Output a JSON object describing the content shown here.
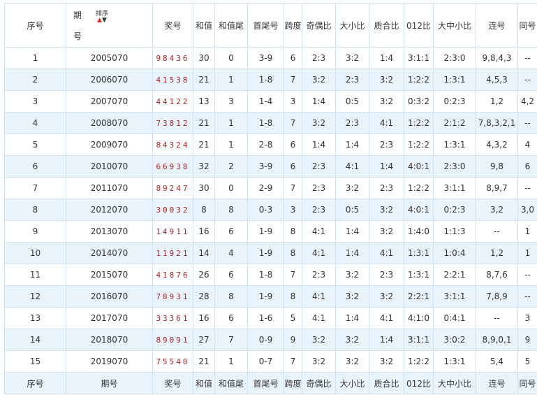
{
  "headers": {
    "index": "序号",
    "period_part1": "期",
    "period_part2": "号",
    "sort_label": "排序",
    "sort_up": "▲",
    "sort_down": "▼",
    "numbers": "奖号",
    "sum": "和值",
    "sum_tail": "和值尾",
    "first_last": "首尾号",
    "span": "跨度",
    "odd_even": "奇偶比",
    "big_small": "大小比",
    "prime_composite": "质合比",
    "ratio_012": "012比",
    "big_mid_small": "大中小比",
    "consecutive": "连号",
    "same": "同号"
  },
  "footer": {
    "index": "序号",
    "period": "期号",
    "numbers": "奖号",
    "sum": "和值",
    "sum_tail": "和值尾",
    "first_last": "首尾号",
    "span": "跨度",
    "odd_even": "奇偶比",
    "big_small": "大小比",
    "prime_composite": "质合比",
    "ratio_012": "012比",
    "big_mid_small": "大中小比",
    "consecutive": "连号",
    "same": "同号"
  },
  "rows": [
    [
      "1",
      "2005070",
      "98436",
      "30",
      "0",
      "3-9",
      "6",
      "2:3",
      "3:2",
      "1:4",
      "3:1:1",
      "2:3:0",
      "9,8,4,3",
      "--"
    ],
    [
      "2",
      "2006070",
      "41538",
      "21",
      "1",
      "1-8",
      "7",
      "3:2",
      "2:3",
      "3:2",
      "1:2:2",
      "1:3:1",
      "4,5,3",
      "--"
    ],
    [
      "3",
      "2007070",
      "44122",
      "13",
      "3",
      "1-4",
      "3",
      "1:4",
      "0:5",
      "3:2",
      "0:3:2",
      "0:2:3",
      "1,2",
      "4,2"
    ],
    [
      "4",
      "2008070",
      "73812",
      "21",
      "1",
      "1-8",
      "7",
      "3:2",
      "2:3",
      "4:1",
      "1:2:2",
      "2:1:2",
      "7,8,3,2,1",
      "--"
    ],
    [
      "5",
      "2009070",
      "84324",
      "21",
      "1",
      "2-8",
      "6",
      "1:4",
      "1:4",
      "2:3",
      "1:2:2",
      "1:3:1",
      "4,3,2",
      "4"
    ],
    [
      "6",
      "2010070",
      "66938",
      "32",
      "2",
      "3-9",
      "6",
      "2:3",
      "4:1",
      "1:4",
      "4:0:1",
      "2:3:0",
      "9,8",
      "6"
    ],
    [
      "7",
      "2011070",
      "89247",
      "30",
      "0",
      "2-9",
      "7",
      "2:3",
      "3:2",
      "2:3",
      "1:2:2",
      "3:1:1",
      "8,9,7",
      "--"
    ],
    [
      "8",
      "2012070",
      "30032",
      "8",
      "8",
      "0-3",
      "3",
      "2:3",
      "0:5",
      "3:2",
      "4:0:1",
      "0:2:3",
      "3,2",
      "3,0"
    ],
    [
      "9",
      "2013070",
      "14911",
      "16",
      "6",
      "1-9",
      "8",
      "4:1",
      "1:4",
      "3:2",
      "1:4:0",
      "1:1:3",
      "--",
      "1"
    ],
    [
      "10",
      "2014070",
      "11921",
      "14",
      "4",
      "1-9",
      "8",
      "4:1",
      "1:4",
      "4:1",
      "1:3:1",
      "1:0:4",
      "1,2",
      "1"
    ],
    [
      "11",
      "2015070",
      "41876",
      "26",
      "6",
      "1-8",
      "7",
      "2:3",
      "3:2",
      "2:3",
      "1:3:1",
      "2:2:1",
      "8,7,6",
      "--"
    ],
    [
      "12",
      "2016070",
      "78931",
      "28",
      "8",
      "1-9",
      "8",
      "4:1",
      "3:2",
      "3:2",
      "2:2:1",
      "3:1:1",
      "7,8,9",
      "--"
    ],
    [
      "13",
      "2017070",
      "33361",
      "16",
      "6",
      "1-6",
      "5",
      "4:1",
      "1:4",
      "4:1",
      "4:1:0",
      "0:4:1",
      "--",
      "3"
    ],
    [
      "14",
      "2018070",
      "89091",
      "27",
      "7",
      "0-9",
      "9",
      "3:2",
      "3:2",
      "1:4",
      "3:1:1",
      "3:0:2",
      "8,9,0,1",
      "9"
    ],
    [
      "15",
      "2019070",
      "75540",
      "21",
      "1",
      "0-7",
      "7",
      "3:2",
      "3:2",
      "3:2",
      "1:2:2",
      "1:3:1",
      "5,4",
      "5"
    ]
  ]
}
